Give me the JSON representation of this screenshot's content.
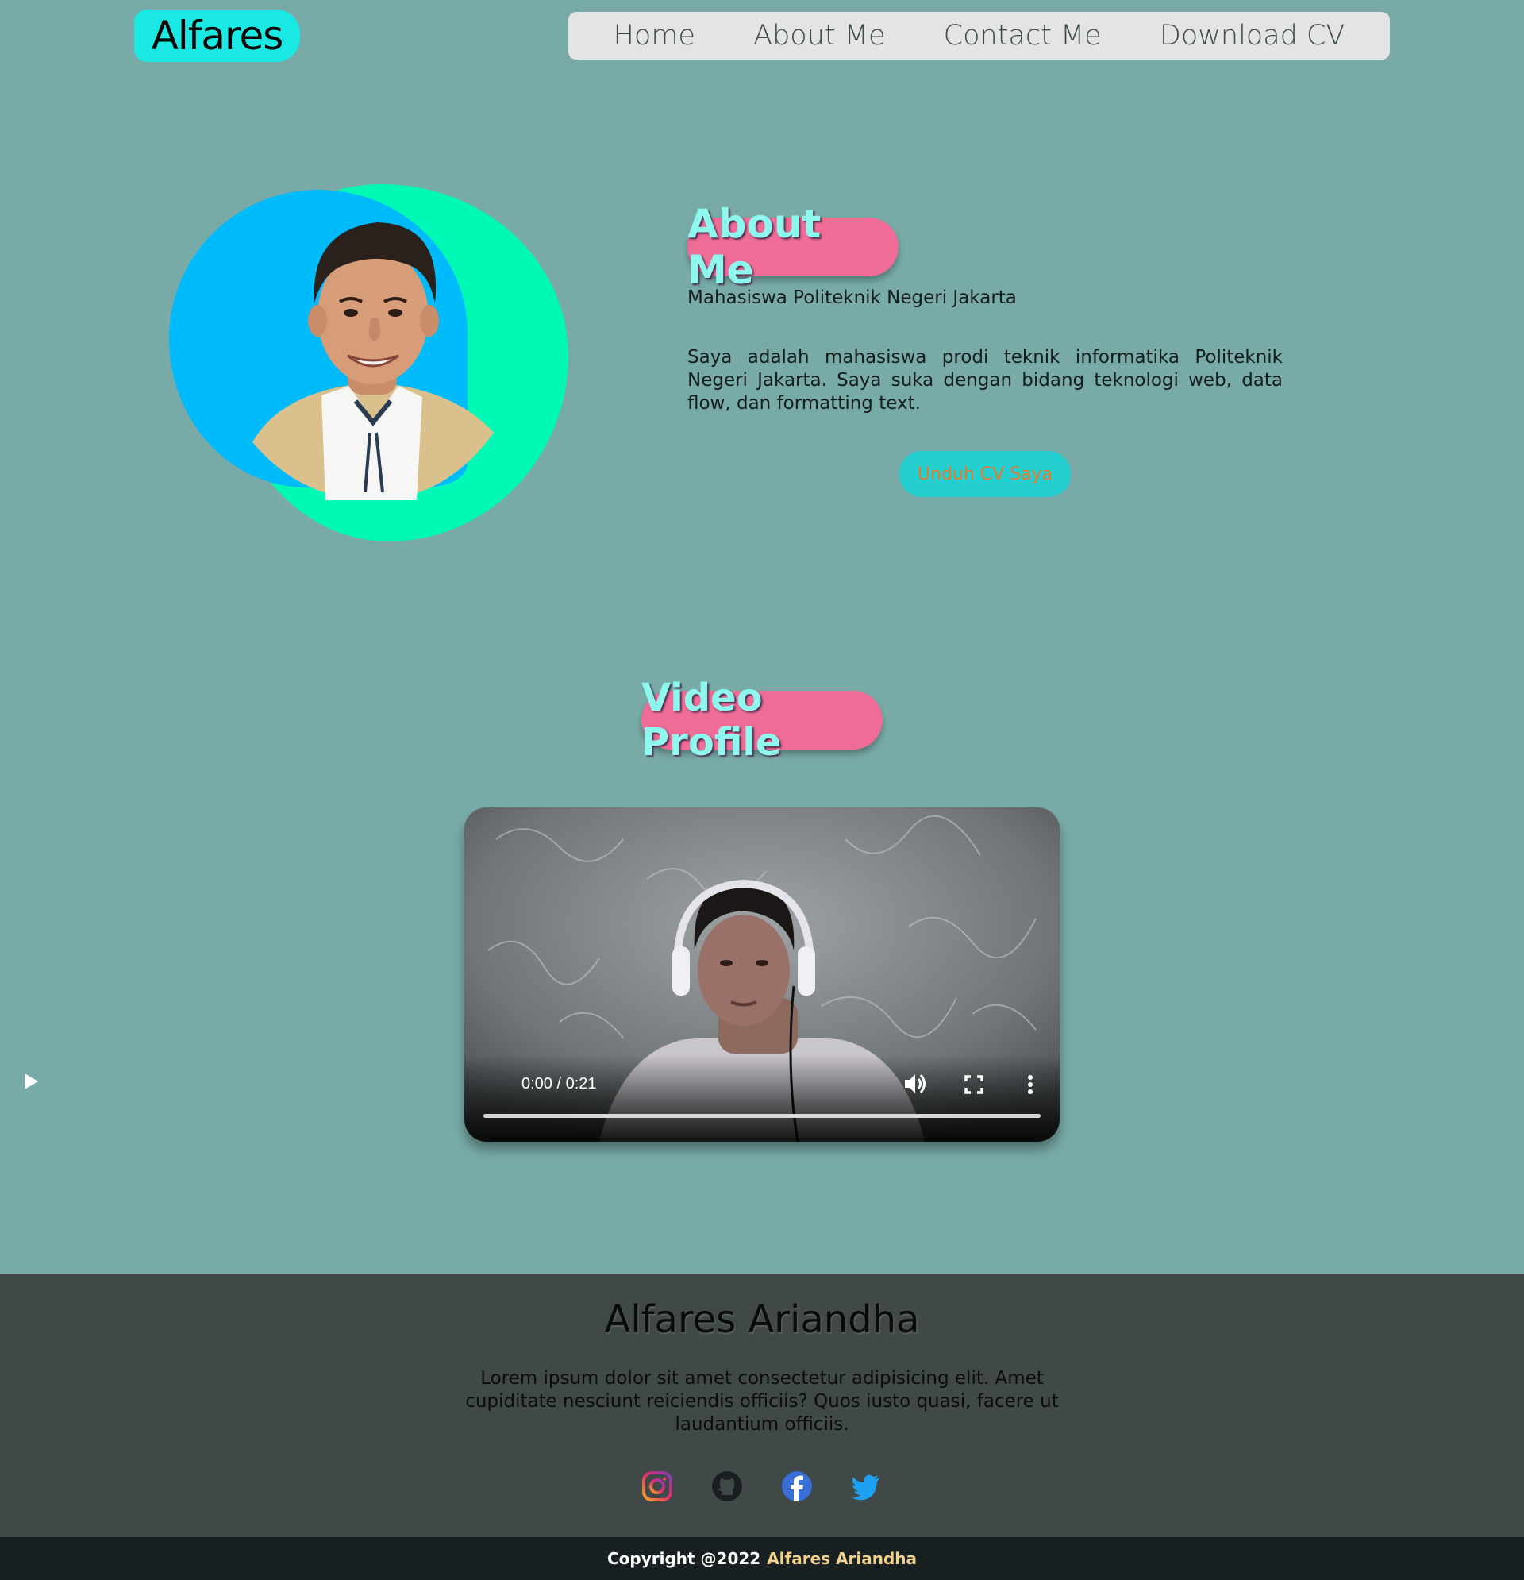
{
  "header": {
    "logo": "Alfares",
    "nav": [
      "Home",
      "About Me",
      "Contact Me",
      "Download CV"
    ]
  },
  "about": {
    "heading": "About Me",
    "subtitle": "Mahasiswa Politeknik Negeri Jakarta",
    "description": "Saya adalah mahasiswa prodi teknik informatika Politeknik Negeri Jakarta. Saya suka dengan bidang teknologi web, data flow, dan formatting text.",
    "cv_button": "Unduh CV Saya"
  },
  "video": {
    "heading": "Video Profile",
    "time": "0:00 / 0:21",
    "progress": 0
  },
  "footer": {
    "name": "Alfares Ariandha",
    "description": "Lorem ipsum dolor sit amet consectetur adipisicing elit. Amet cupiditate nesciunt reiciendis officiis? Quos iusto quasi, facere ut laudantium officiis.",
    "social_icons": [
      "instagram-icon",
      "github-icon",
      "facebook-icon",
      "twitter-icon"
    ],
    "copyright_prefix": "Copyright @2022",
    "copyright_name": "Alfares Ariandha"
  },
  "colors": {
    "background": "#78aba7",
    "accent_pink": "#ee6c96",
    "heading_text": "#8ff8ee",
    "logo_bg": "#1ae8e3",
    "footer_bg": "#414848",
    "copyright_bg": "#182022"
  }
}
